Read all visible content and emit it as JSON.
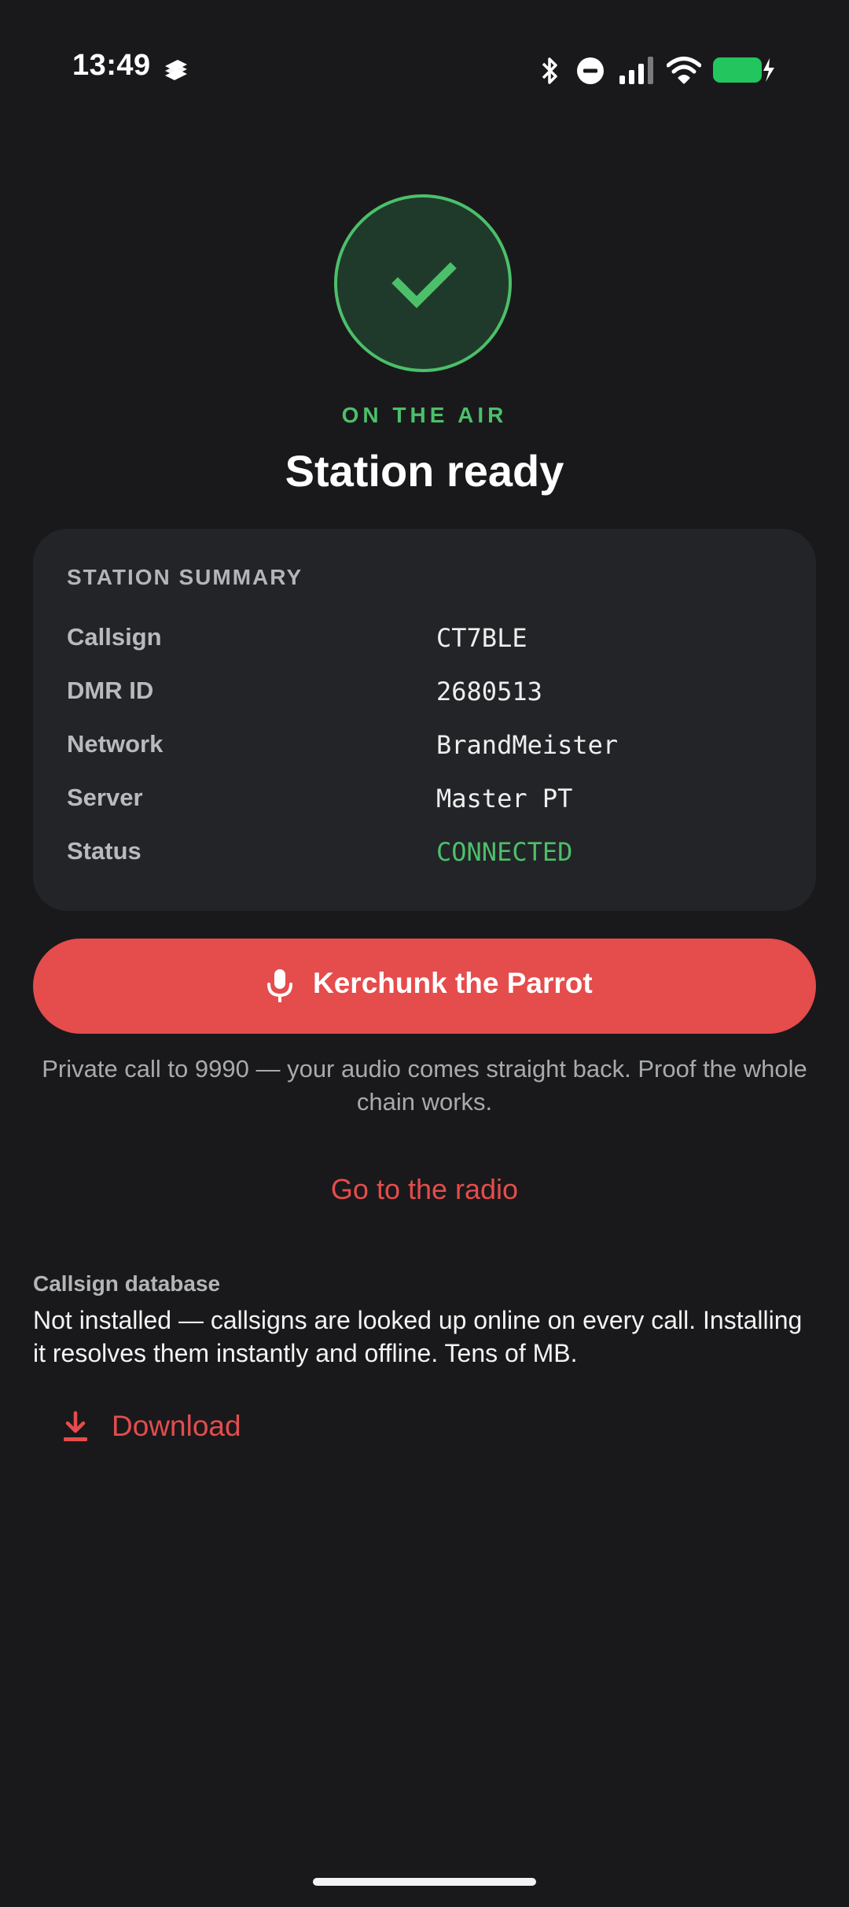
{
  "status_bar": {
    "time": "13:49",
    "icons": [
      "notification-app-icon",
      "bluetooth-icon",
      "do-not-disturb-icon",
      "cell-signal-icon",
      "wifi-icon",
      "battery-charging-icon"
    ],
    "battery_color": "#22c55e"
  },
  "hero": {
    "icon": "check-icon",
    "eyebrow": "ON THE AIR",
    "title": "Station ready"
  },
  "summary": {
    "heading": "STATION SUMMARY",
    "rows": [
      {
        "label": "Callsign",
        "value": "CT7BLE"
      },
      {
        "label": "DMR ID",
        "value": "2680513"
      },
      {
        "label": "Network",
        "value": "BrandMeister"
      },
      {
        "label": "Server",
        "value": "Master PT"
      },
      {
        "label": "Status",
        "value": "CONNECTED"
      }
    ]
  },
  "actions": {
    "kerchunk_label": "Kerchunk the Parrot",
    "kerchunk_icon": "microphone-icon",
    "kerchunk_hint": "Private call to 9990 — your audio comes straight back. Proof the whole chain works.",
    "goto_radio": "Go to the radio"
  },
  "database": {
    "title": "Callsign database",
    "description": "Not installed — callsigns are looked up online on every call. Installing it resolves them instantly and offline. Tens of MB.",
    "download_label": "Download",
    "download_icon": "download-icon"
  },
  "colors": {
    "accent_red": "#e54c4c",
    "success_green": "#4cbf6a",
    "background": "#19191b",
    "card": "#222427"
  }
}
